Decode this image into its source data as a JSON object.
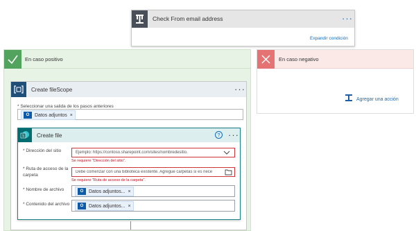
{
  "condition_card": {
    "title": "Check From email address",
    "menu_label": "···",
    "expand_link": "Expandir condición"
  },
  "positive_branch": {
    "title": "En caso positivo",
    "scope": {
      "title": "Create fileScope",
      "menu_label": "···",
      "select_label": "* Seleccionar una salida de los pasos anteriores",
      "select_chip": "Datos adjuntos",
      "chip_remove": "×",
      "action": {
        "title": "Create file",
        "help_label": "?",
        "menu_label": "···",
        "fields": [
          {
            "label": "* Dirección del sitio",
            "placeholder": "Ejemplo: https://contoso.sharepoint.com/sites/nombredesitio.",
            "error": "Se requiere \"Dirección del sitio\"."
          },
          {
            "label": "* Ruta de acceso de la carpeta",
            "placeholder": "Debe comenzar con una biblioteca existente. Agregue carpetas si es nece",
            "error": "Se requiere \"Ruta de acceso de la carpeta\"."
          },
          {
            "label": "* Nombre de archivo",
            "chip": "Datos adjuntos..."
          },
          {
            "label": "* Contenido del archivo",
            "chip": "Datos adjuntos..."
          }
        ]
      }
    }
  },
  "negative_branch": {
    "title": "En caso negativo",
    "add_action": "Agregar una acción"
  },
  "colors": {
    "positive_bg": "#e7f3e4",
    "positive_icon_bg": "#52a35e",
    "negative_bg": "#fbe9e8",
    "negative_icon_bg": "#e57373",
    "scope_header_bg": "#e9eef3",
    "scope_icon_bg": "#1f4e79",
    "sharepoint_header_bg": "#dcefee",
    "sharepoint_icon_bg": "#036c70",
    "condition_icon_bg": "#484f58",
    "error_red": "#c50f1f",
    "link_blue": "#0f6cbd"
  },
  "icons": {
    "condition": "condition-icon",
    "check": "check-icon",
    "cross": "cross-icon",
    "scope": "scope-icon",
    "sharepoint": "sharepoint-icon",
    "add_action": "add-action-icon",
    "dropdown": "chevron-down-icon",
    "folder": "folder-icon",
    "outlook": "outlook-icon",
    "help": "help-icon"
  }
}
